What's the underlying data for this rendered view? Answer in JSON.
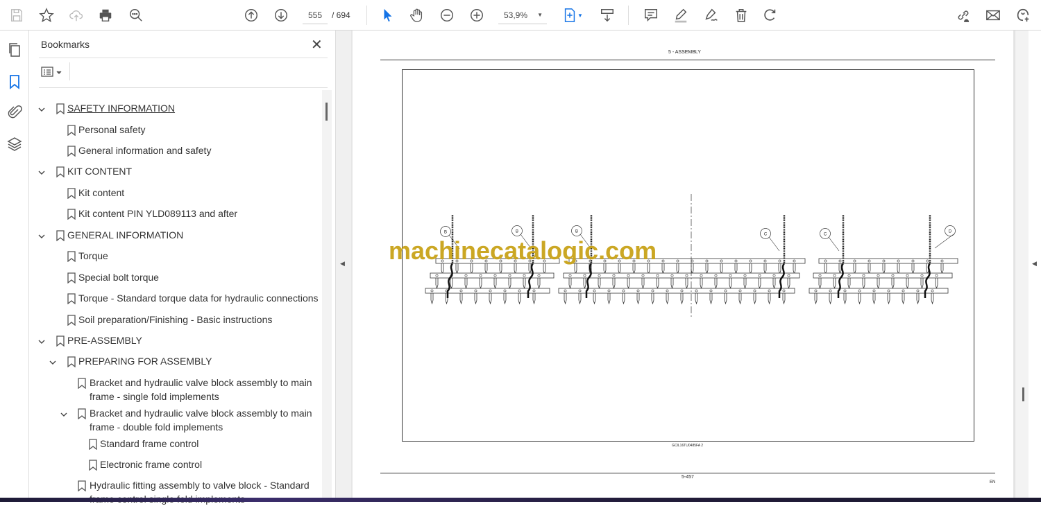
{
  "toolbar": {
    "current_page": "555",
    "total_pages": "/ 694",
    "zoom": "53,9%",
    "icons": [
      "save-icon",
      "bookmark-star-icon",
      "cloud-upload-icon",
      "print-icon",
      "search-zoom-icon",
      "page-up-icon",
      "page-down-icon",
      "select-arrow-icon",
      "hand-icon",
      "zoom-out-icon",
      "zoom-in-icon",
      "fit-page-icon",
      "scroll-mode-icon",
      "comment-icon",
      "highlight-icon",
      "sign-icon",
      "delete-icon",
      "rotate-icon",
      "share-link-icon",
      "email-icon",
      "add-user-icon"
    ]
  },
  "bookmarks": {
    "title": "Bookmarks",
    "items": [
      {
        "label": "SAFETY INFORMATION",
        "level": 0,
        "expanded": true,
        "link": true
      },
      {
        "label": "Personal safety",
        "level": 1
      },
      {
        "label": "General information and safety",
        "level": 1
      },
      {
        "label": "KIT CONTENT",
        "level": 0,
        "expanded": true
      },
      {
        "label": "Kit content",
        "level": 1
      },
      {
        "label": "Kit content PIN YLD089113 and after",
        "level": 1
      },
      {
        "label": "GENERAL INFORMATION",
        "level": 0,
        "expanded": true
      },
      {
        "label": "Torque",
        "level": 1
      },
      {
        "label": "Special bolt torque",
        "level": 1
      },
      {
        "label": "Torque - Standard torque data for hydraulic connections",
        "level": 1
      },
      {
        "label": "Soil preparation/Finishing - Basic instructions",
        "level": 1
      },
      {
        "label": "PRE-ASSEMBLY",
        "level": 0,
        "expanded": true
      },
      {
        "label": "PREPARING FOR ASSEMBLY",
        "level": 1,
        "expanded": true
      },
      {
        "label": "Bracket and hydraulic valve block assembly to main",
        "label2": "frame - single fold implements",
        "level": 2
      },
      {
        "label": "Bracket and hydraulic valve block assembly to main",
        "label2": "frame - double fold implements",
        "level": 2,
        "expanded": true
      },
      {
        "label": "Standard frame control",
        "level": 3
      },
      {
        "label": "Electronic frame control",
        "level": 3
      },
      {
        "label": "Hydraulic fitting assembly to valve block - Standard",
        "label2": "frame control single fold implements",
        "level": 2
      }
    ]
  },
  "document": {
    "header": "5 - ASSEMBLY",
    "figure_id": "GCIL16TU0485FA   2",
    "callouts": [
      "B",
      "B",
      "B",
      "C",
      "C",
      "D"
    ],
    "page_number": "5-457",
    "language": "EN",
    "watermark": "machinecatalogic.com"
  },
  "colors": {
    "accent": "#1473e6",
    "watermark": "#c9a319"
  }
}
